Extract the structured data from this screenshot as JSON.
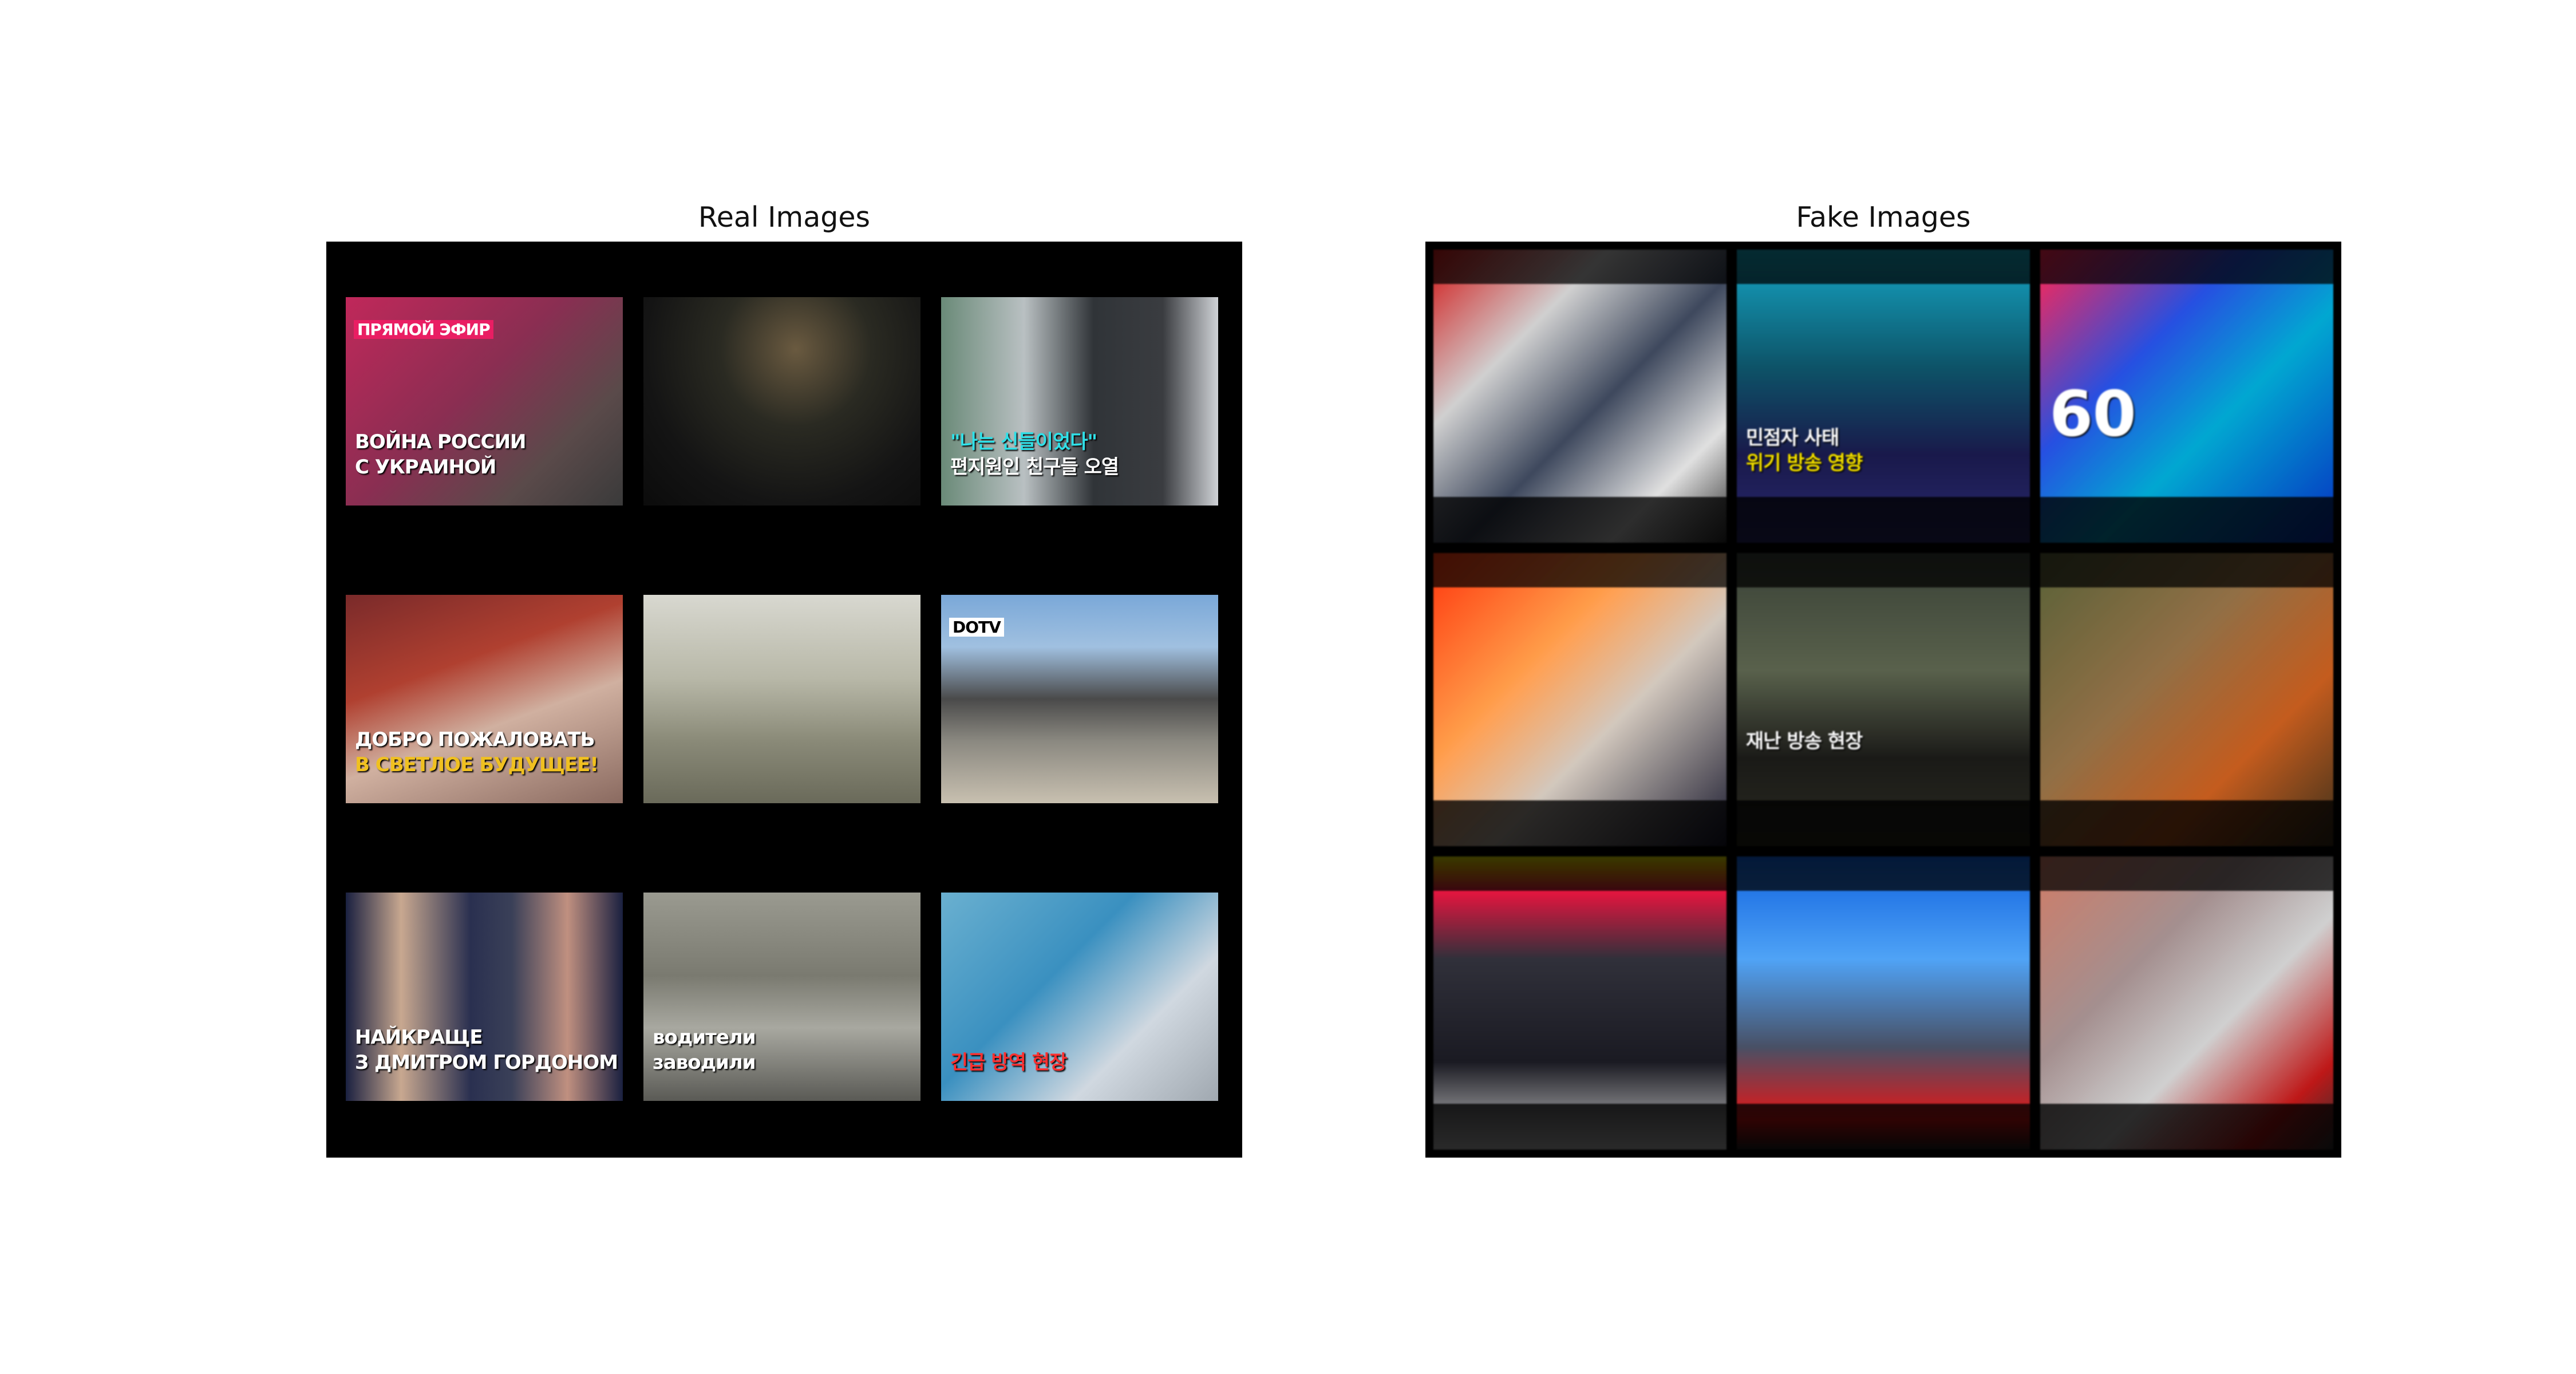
{
  "panels": [
    {
      "title": "Real Images",
      "kind": "real",
      "tiles": [
        {
          "label": "live-broadcast-war",
          "bg": "linear-gradient(135deg,#c0285a 0%,#8a2e52 45%,#5a4a4a 75%,#3a3a3a 100%)",
          "badge": "ПРЯМОЙ ЭФИР",
          "badge_color": "#e91e63",
          "lines": [
            "ВОЙНА РОССИИ",
            "С УКРАИНОЙ"
          ]
        },
        {
          "label": "crowd-protest-night",
          "bg": "radial-gradient(ellipse at 55% 25%,#6a5a40 0%,#2a2a22 35%,#141414 70%,#0b0b0b 100%)",
          "lines": []
        },
        {
          "label": "memorial-portrait-news",
          "bg": "linear-gradient(90deg,#6a8a78 0%,#b9c0c2 30%,#303438 55%,#3a3c40 80%,#cfd2d6 100%)",
          "lines": [
            "\"나는 신들이었다\"",
            "편지원인 친구들 오열"
          ],
          "line_colors": [
            "#30e0e8",
            "#ffffff"
          ]
        },
        {
          "label": "politicians-welcome-banner",
          "bg": "linear-gradient(160deg,#7a2a2a 0%,#b04030 35%,#d0b0a0 60%,#8a6a60 100%)",
          "lines": [
            "ДОБРО ПОЖАЛОВАТЬ",
            "В СВЕТЛОЕ БУДУЩЕЕ!"
          ],
          "line_colors": [
            "#ffffff",
            "#f0c020"
          ]
        },
        {
          "label": "armored-vehicle-street",
          "bg": "linear-gradient(180deg,#d8d8d0 0%,#b8b8a8 40%,#8a8a78 70%,#6a6a5a 100%)",
          "lines": []
        },
        {
          "label": "smoke-over-building",
          "bg": "linear-gradient(180deg,#7aa8d8 0%,#a0c0e0 25%,#4a4a4a 50%,#8a8880 70%,#c8c0b0 100%)",
          "badge": "DOTV",
          "badge_color": "#ffffff",
          "lines": []
        },
        {
          "label": "podcast-hosts",
          "bg": "linear-gradient(90deg,#1a2040 0%,#c8a890 20%,#2a3050 45%,#3a4058 60%,#c09080 80%,#1a2040 100%)",
          "lines": [
            "НАЙКРАЩЕ",
            "З ДМИТРОМ ГОРДОНОМ"
          ]
        },
        {
          "label": "mountain-road-cars",
          "bg": "linear-gradient(180deg,#9a9a90 0%,#7a7a70 40%,#a8a8a0 65%,#5a5a55 100%)",
          "lines": [
            "водители",
            "заводили"
          ]
        },
        {
          "label": "hazmat-workers",
          "bg": "linear-gradient(135deg,#6ab0d0 0%,#3a90c0 40%,#d0d8e0 70%,#a0a8b0 100%)",
          "lines": [
            "긴급 방역 현장"
          ],
          "line_colors": [
            "#ff3030"
          ]
        }
      ]
    },
    {
      "title": "Fake Images",
      "kind": "fake",
      "tiles": [
        {
          "label": "generated-frame-anchor",
          "bg": "linear-gradient(135deg,#b02020 0%,#d0d0d0 30%,#404858 55%,#e0e0e0 80%,#303030 100%)",
          "lines": []
        },
        {
          "label": "generated-frame-yellow-caption",
          "bg": "linear-gradient(180deg,#30a0b8 0%,#1a5060 40%,#1a1a40 70%,#2a2a60 100%)",
          "lines": [
            "민점자 사태",
            "위기 방송 영향"
          ],
          "line_colors": [
            "#ffffff",
            "#f0e020"
          ]
        },
        {
          "label": "generated-frame-60",
          "bg": "linear-gradient(135deg,#e03050 0%,#3050c0 35%,#20a0c0 60%,#1030a0 100%)",
          "lines": [
            "60"
          ]
        },
        {
          "label": "generated-frame-fire",
          "bg": "linear-gradient(135deg,#e04020 0%,#f0a060 35%,#d0c8c0 60%,#1a1a2a 100%)",
          "lines": []
        },
        {
          "label": "generated-frame-dark-caption",
          "bg": "linear-gradient(180deg,#3a4038 0%,#5a6050 40%,#1a1a18 70%,#2a2a22 100%)",
          "lines": [
            "재난 방송 현장"
          ]
        },
        {
          "label": "generated-frame-crowd",
          "bg": "linear-gradient(135deg,#5a6040 0%,#8a7050 40%,#b06030 70%,#3a3020 100%)",
          "lines": []
        },
        {
          "label": "generated-frame-yellow-bar",
          "bg": "linear-gradient(180deg,#e0e020 0%,#c02040 12%,#303038 35%,#1a1a20 70%,#d0d0d0 100%)",
          "lines": []
        },
        {
          "label": "generated-frame-blue-sky",
          "bg": "linear-gradient(180deg,#2060c0 0%,#60a0e0 35%,#4a5060 65%,#c02020 90%,#202020 100%)",
          "lines": []
        },
        {
          "label": "generated-frame-street",
          "bg": "linear-gradient(135deg,#c08070 0%,#a09090 35%,#d0d0d0 60%,#a02020 85%,#303030 100%)",
          "lines": []
        }
      ]
    }
  ]
}
